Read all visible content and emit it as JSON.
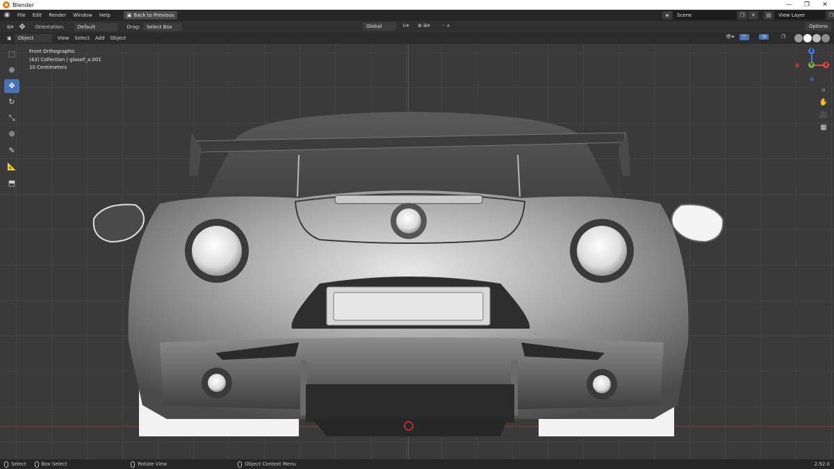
{
  "window": {
    "title": "Blender",
    "controls": [
      "—",
      "❐",
      "✕"
    ]
  },
  "menubar": {
    "items": [
      "File",
      "Edit",
      "Render",
      "Window",
      "Help"
    ],
    "back_button": "Back to Previous",
    "scene_label": "Scene",
    "view_layer_label": "View Layer"
  },
  "toolheader": {
    "orientation_label": "Orientation:",
    "orientation_value": "Default",
    "drag_label": "Drag:",
    "drag_value": "Select Box",
    "transform_space": "Global",
    "options_label": "Options"
  },
  "viewport_header": {
    "mode": "Object Mode",
    "menus": [
      "View",
      "Select",
      "Add",
      "Object"
    ]
  },
  "viewport_overlay": {
    "view_name": "Front Orthographic",
    "collection_line": "(43) Collection | glassif_a.001",
    "scale_line": "10 Centimeters"
  },
  "gizmo": {
    "z_label": "Z",
    "y_label": "Y",
    "x_label": "X"
  },
  "statusbar": {
    "select": "Select",
    "box_select": "Box Select",
    "rotate_view": "Rotate View",
    "context_menu": "Object Context Menu",
    "version": "2.92.0"
  },
  "colors": {
    "accent": "#4772b3",
    "x_axis": "#e04b4b",
    "y_axis": "#76b041",
    "z_axis": "#3f80e0"
  }
}
